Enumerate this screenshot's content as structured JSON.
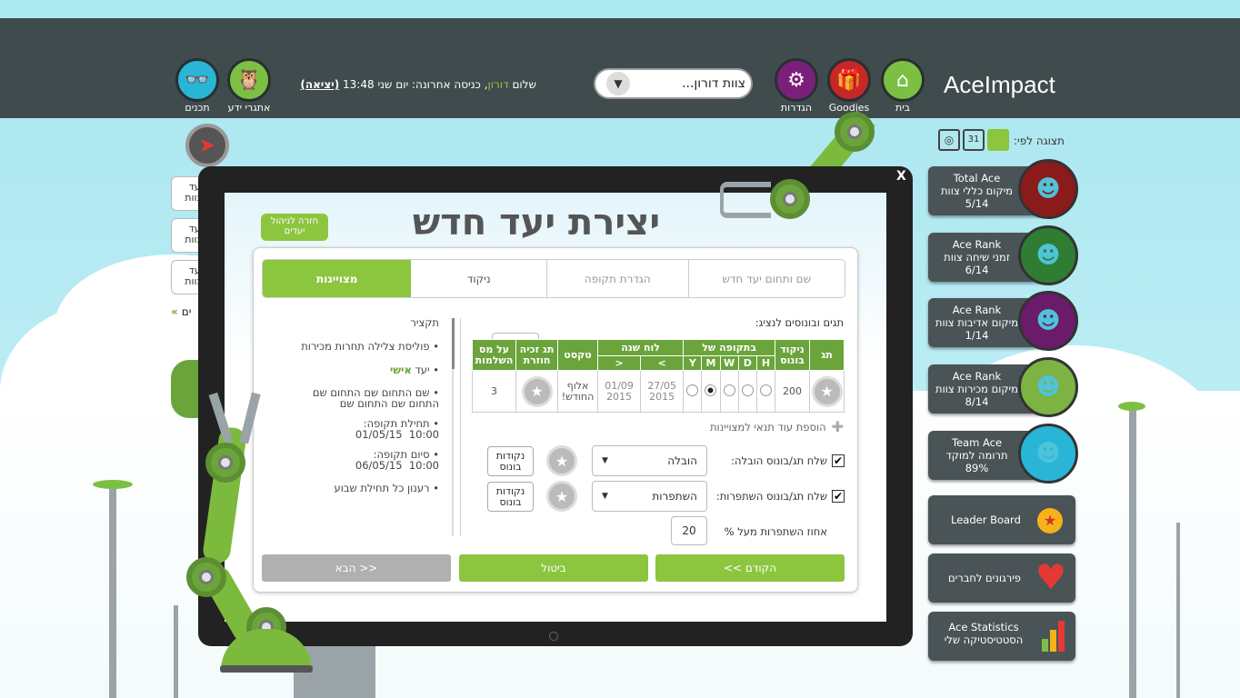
{
  "header": {
    "logo": "AceImpact",
    "nav": [
      {
        "label": "בית",
        "icon": "home-icon"
      },
      {
        "label": "Goodies",
        "icon": "gift-icon"
      },
      {
        "label": "הגדרות",
        "icon": "gear-icon"
      }
    ],
    "team_select": "צוות דורון...",
    "greeting_prefix": "שלום ",
    "user_name": "דורון",
    "last_login": ", כניסה אחרונה: יום שני 13:48 ",
    "logout": "(יציאה)",
    "right_icons": [
      {
        "label": "אתגרי ידע",
        "icon": "owl-icon"
      },
      {
        "label": "תכנים",
        "icon": "3d-glasses-icon"
      }
    ]
  },
  "view_by": {
    "label": "תצוגה לפי:"
  },
  "side_cards": [
    {
      "title": "Total Ace",
      "sub": "מיקום כללי צוות",
      "value": "5/14",
      "color": "#8b1a1a"
    },
    {
      "title": "Ace Rank",
      "sub": "זמני שיחה צוות",
      "value": "6/14",
      "color": "#2e7d32"
    },
    {
      "title": "Ace Rank",
      "sub": "מיקום אדיבות צוות",
      "value": "1/14",
      "color": "#6a1b6a"
    },
    {
      "title": "Ace Rank",
      "sub": "מיקום מכירות צוות",
      "value": "8/14",
      "color": "#7cb342"
    },
    {
      "title": "Team Ace",
      "sub": "תרומה למוקד",
      "value": "89%",
      "color": "#29b6d6"
    }
  ],
  "side_buttons": [
    {
      "label": "Leader Board",
      "icon": "medal-icon"
    },
    {
      "label": "פירגונים לחברים",
      "icon": "heart-icon"
    },
    {
      "label": "Ace Statistics",
      "sub": "הסטטיסטיקה שלי",
      "icon": "bar-chart-icon"
    }
  ],
  "left_tabs": [
    "יעד\nצוות",
    "יעד\nצוות",
    "יעד\nצוות"
  ],
  "left_more": "ים",
  "modal": {
    "close": "X",
    "title": "יצירת יעד חדש",
    "back_label": "חזרה לניהול\nיעדים",
    "steps": [
      "שם ותחום יעד חדש",
      "הגדרת תקופה",
      "ניקוד",
      "מצויינות"
    ],
    "summary_title": "תקציר",
    "summary_items": [
      {
        "text": "פוליסת צלילה תחרות מכירות"
      },
      {
        "text_a": "יעד ",
        "text_b": "אישי"
      },
      {
        "text": "שם התחום שם התחום שם\nהתחום שם התחום שם"
      },
      {
        "text": "תחילת תקופה:\n10:00  01/05/15"
      },
      {
        "text": "סיום תקופה:\n10:00  06/05/15"
      },
      {
        "text": "רענון כל תחילת שבוע"
      }
    ],
    "tags_title": "תגים ובונוסים לנציג:",
    "table": {
      "headers": [
        "תג",
        "ניקוד בונוס",
        "בתקופה של",
        "לוח שנה",
        "טקסט",
        "תג זכיה חוזרת",
        "על מס השלמות"
      ],
      "period_cols": [
        "H",
        "D",
        "W",
        "M",
        "Y"
      ],
      "cal_cols": [
        ">",
        "<"
      ],
      "row": {
        "bonus": "200",
        "selected_period": "M",
        "cal_from": "27/05\n2015",
        "cal_to": "01/09\n2015",
        "text": "אלוף\nהחודש!",
        "count": "3"
      }
    },
    "add_condition": "הוספת עוד תנאי למצויינות",
    "rows": [
      {
        "check_label": "שלח תג/בונוס הובלה:",
        "select": "הובלה",
        "points": "נקודות\nבונוס"
      },
      {
        "check_label": "שלח תג/בונוס השתפרות:",
        "select": "השתפרות",
        "points": "נקודות\nבונוס"
      }
    ],
    "percent_label": "אחוז השתפרות מעל %",
    "percent_value": "20",
    "btn_prev": "<<  הקודם",
    "btn_cancel": "ביטול",
    "btn_next": "הבא  >>",
    "colors": {
      "green": "#8cc63f",
      "gray": "#b0b0b0"
    }
  }
}
